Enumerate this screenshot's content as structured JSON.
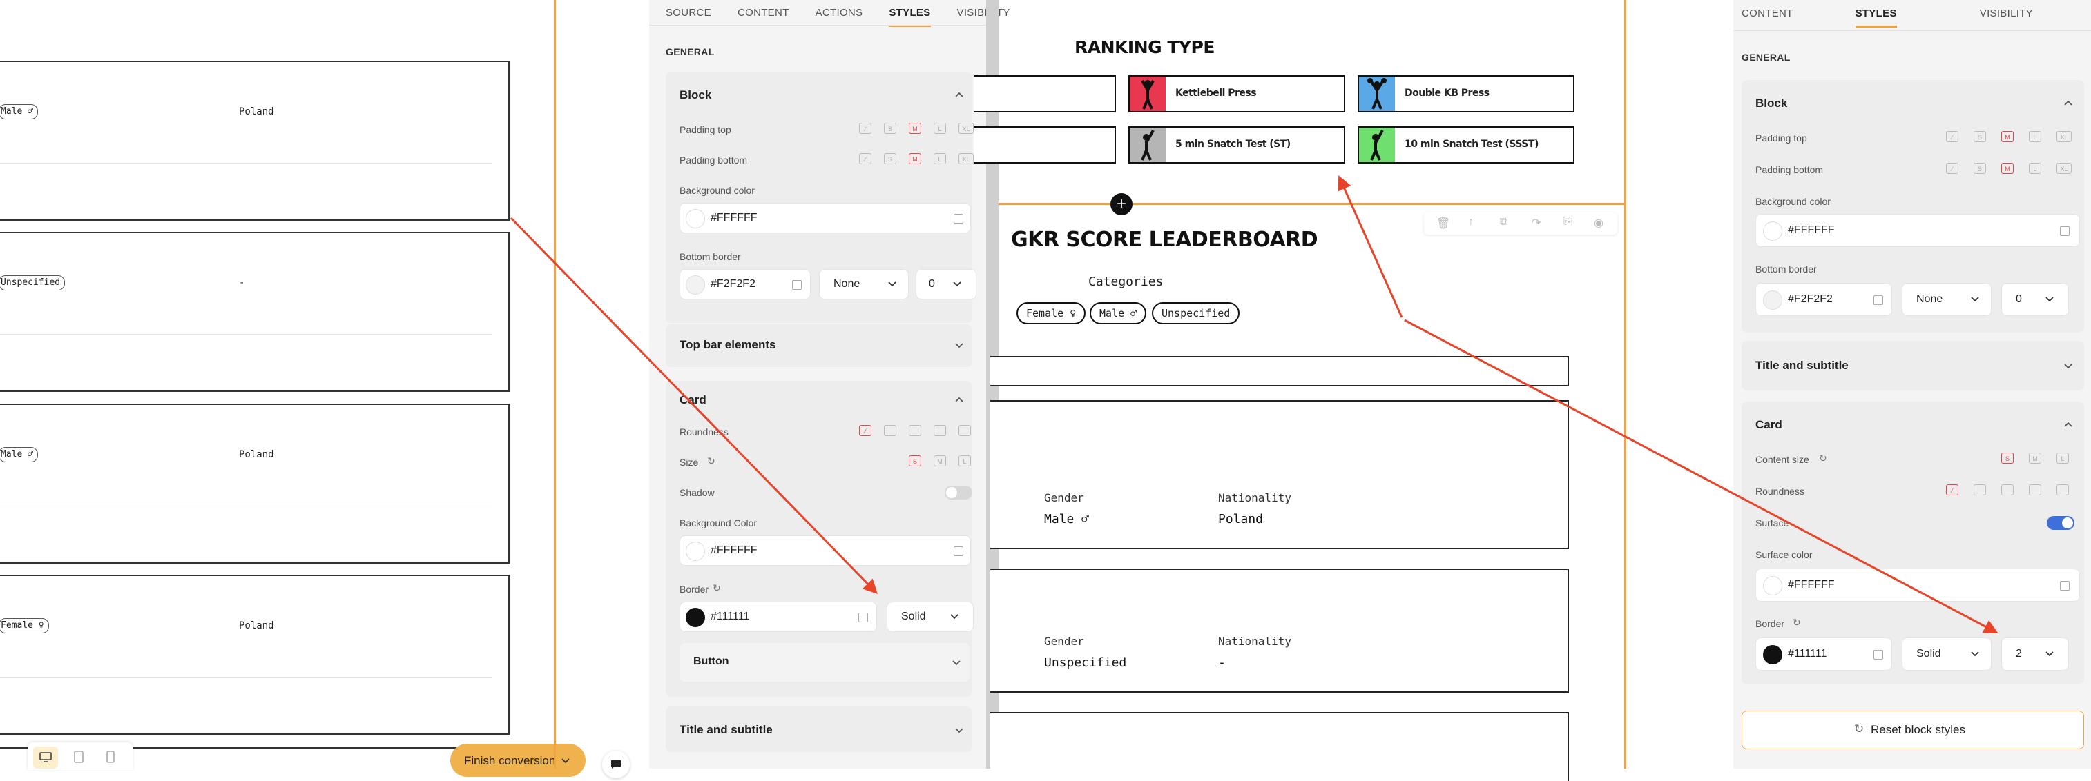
{
  "canvas_left": {
    "cards": [
      {
        "tag": "Male ♂",
        "nationality": "Poland"
      },
      {
        "tag": "Unspecified",
        "nationality": "-"
      },
      {
        "tag": "Male ♂",
        "nationality": "Poland"
      },
      {
        "tag": "Female ♀",
        "nationality": "Poland"
      }
    ],
    "finish_button": "Finish conversion"
  },
  "panel1": {
    "tabs": [
      "SOURCE",
      "CONTENT",
      "ACTIONS",
      "STYLES",
      "VISIBILITY"
    ],
    "active_tab": "STYLES",
    "general_label": "GENERAL",
    "block": {
      "title": "Block",
      "padding_top": "Padding top",
      "padding_bottom": "Padding bottom",
      "background_color_label": "Background color",
      "background_color": "#FFFFFF",
      "bottom_border_label": "Bottom border",
      "bottom_border_color": "#F2F2F2",
      "bottom_border_style": "None",
      "bottom_border_width": "0"
    },
    "top_bar": "Top bar elements",
    "card": {
      "title": "Card",
      "roundness": "Roundness",
      "size": "Size",
      "size_options": [
        "S",
        "M",
        "L"
      ],
      "shadow": "Shadow",
      "background_color_label": "Background Color",
      "background_color": "#FFFFFF",
      "border_label": "Border",
      "border_color": "#111111",
      "border_style": "Solid"
    },
    "button": "Button",
    "title_subtitle": "Title and subtitle"
  },
  "size_chips": [
    "S",
    "M",
    "L",
    "XL"
  ],
  "ranking": {
    "title": "RANKING TYPE",
    "buttons": [
      {
        "label": "Kettlebell Press",
        "color": "#e8384f"
      },
      {
        "label": "Double KB Press",
        "color": "#5aa9e6"
      },
      {
        "label": "5 min Snatch Test (ST)",
        "color": "#b5b5b5"
      },
      {
        "label": "10 min Snatch Test (SSST)",
        "color": "#6fe06f"
      }
    ]
  },
  "leaderboard": {
    "title": "GKR SCORE LEADERBOARD",
    "categories_label": "Categories",
    "categories": [
      "Female ♀",
      "Male ♂",
      "Unspecified"
    ],
    "gender_label": "Gender",
    "nationality_label": "Nationality",
    "rows": [
      {
        "gender": "Male ♂",
        "nationality": "Poland"
      },
      {
        "gender": "Unspecified",
        "nationality": "-"
      }
    ]
  },
  "panel2": {
    "tabs": [
      "CONTENT",
      "STYLES",
      "VISIBILITY"
    ],
    "active_tab": "STYLES",
    "general_label": "GENERAL",
    "block": {
      "title": "Block",
      "padding_top": "Padding top",
      "padding_bottom": "Padding bottom",
      "background_color_label": "Background color",
      "background_color": "#FFFFFF",
      "bottom_border_label": "Bottom border",
      "bottom_border_color": "#F2F2F2",
      "bottom_border_style": "None",
      "bottom_border_width": "0"
    },
    "title_subtitle": "Title and subtitle",
    "card": {
      "title": "Card",
      "content_size": "Content size",
      "size_options": [
        "S",
        "M",
        "L"
      ],
      "roundness": "Roundness",
      "surface": "Surface",
      "surface_color_label": "Surface color",
      "surface_color": "#FFFFFF",
      "border_label": "Border",
      "border_color": "#111111",
      "border_style": "Solid",
      "border_width": "2"
    },
    "reset_button": "Reset block styles"
  },
  "colors": {
    "accent_orange": "#f0a340",
    "annotation_red": "#e8442a",
    "active_toggle": "#3f6fd8",
    "selected_size": "#e0484f"
  }
}
